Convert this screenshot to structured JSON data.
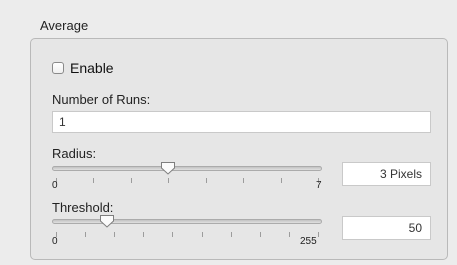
{
  "group": {
    "title": "Average"
  },
  "enable": {
    "label": "Enable",
    "checked": false
  },
  "runs": {
    "label": "Number of Runs:",
    "value": "1"
  },
  "radius": {
    "label": "Radius:",
    "min_label": "0",
    "max_label": "7",
    "value": 3,
    "min": 0,
    "max": 7,
    "ticks": 8,
    "readout": "3 Pixels"
  },
  "threshold": {
    "label": "Threshold:",
    "min_label": "0",
    "max_label": "255",
    "value": 50,
    "min": 0,
    "max": 255,
    "ticks": 10,
    "readout": "50"
  }
}
